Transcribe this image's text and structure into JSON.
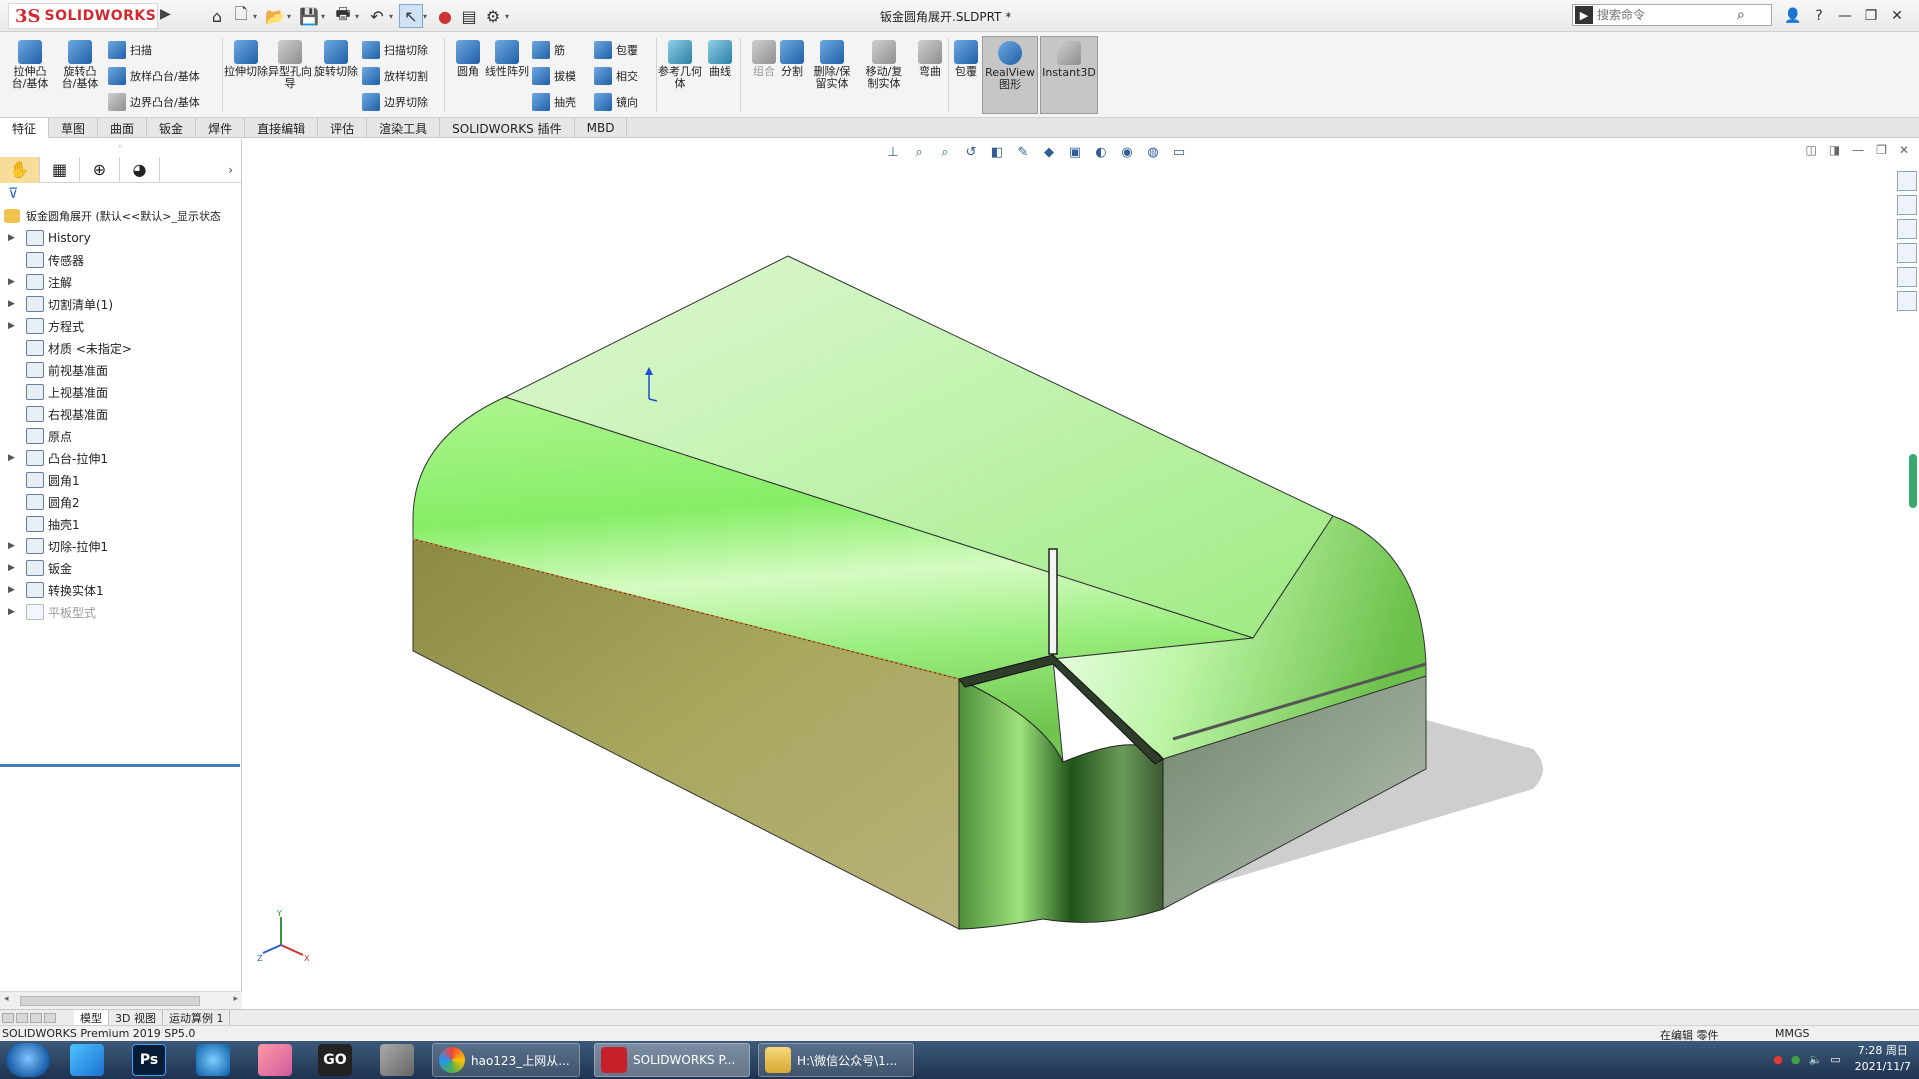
{
  "app": {
    "logo_ds": "3S",
    "logo_word": "SOLIDWORKS",
    "window_title": "钣金圆角展开.SLDPRT *",
    "search_placeholder": "搜索命令"
  },
  "ribbon": {
    "extrude_boss": "拉伸凸台/基体",
    "revolve_boss": "旋转凸台/基体",
    "sweep": "扫描",
    "loft_boss": "放样凸台/基体",
    "boundary_boss": "边界凸台/基体",
    "extrude_cut": "拉伸切除",
    "hole_wizard": "异型孔向导",
    "revolve_cut": "旋转切除",
    "swept_cut": "扫描切除",
    "lofted_cut": "放样切割",
    "boundary_cut": "边界切除",
    "fillet": "圆角",
    "linear_pattern": "线性阵列",
    "rib": "筋",
    "draft": "拔模",
    "shell": "抽壳",
    "wrap": "包覆",
    "intersect": "相交",
    "mirror": "镜向",
    "ref_geometry": "参考几何体",
    "curves": "曲线",
    "combine": "组合",
    "split": "分割",
    "delete_keep_body": "删除/保留实体",
    "move_copy_body": "移动/复制实体",
    "flex": "弯曲",
    "wrap2": "包覆",
    "realview": "RealView图形",
    "instant3d": "Instant3D"
  },
  "tabs": [
    "特征",
    "草图",
    "曲面",
    "钣金",
    "焊件",
    "直接编辑",
    "评估",
    "渲染工具",
    "SOLIDWORKS 插件",
    "MBD"
  ],
  "tree": {
    "root": "钣金圆角展开 (默认<<默认>_显示状态",
    "items": [
      {
        "label": "History",
        "expand": true
      },
      {
        "label": "传感器",
        "expand": false
      },
      {
        "label": "注解",
        "expand": true
      },
      {
        "label": "切割清单(1)",
        "expand": true
      },
      {
        "label": "方程式",
        "expand": true
      },
      {
        "label": "材质 <未指定>",
        "expand": false
      },
      {
        "label": "前视基准面",
        "expand": false
      },
      {
        "label": "上视基准面",
        "expand": false
      },
      {
        "label": "右视基准面",
        "expand": false
      },
      {
        "label": "原点",
        "expand": false
      },
      {
        "label": "凸台-拉伸1",
        "expand": true
      },
      {
        "label": "圆角1",
        "expand": false
      },
      {
        "label": "圆角2",
        "expand": false
      },
      {
        "label": "抽壳1",
        "expand": false
      },
      {
        "label": "切除-拉伸1",
        "expand": true
      },
      {
        "label": "钣金",
        "expand": true
      },
      {
        "label": "转换实体1",
        "expand": true
      },
      {
        "label": "平板型式",
        "expand": true,
        "dim": true
      }
    ]
  },
  "bottom_tabs": [
    "模型",
    "3D 视图",
    "运动算例 1"
  ],
  "status": {
    "left": "SOLIDWORKS Premium 2019 SP5.0",
    "editing": "在编辑 零件",
    "units": "MMGS"
  },
  "triad": {
    "x": "X",
    "y": "Y",
    "z": "Z"
  },
  "taskbar": {
    "tasks": [
      "hao123_上网从...",
      "SOLIDWORKS P...",
      "H:\\微信公众号\\1..."
    ],
    "ps_label": "Ps",
    "gox_label": "GO",
    "time": "7:28 周日",
    "date": "2021/11/7"
  },
  "colors": {
    "accent": "#3b7fc4",
    "model_green": "#8ff07a",
    "model_olive": "#9a9a52"
  }
}
